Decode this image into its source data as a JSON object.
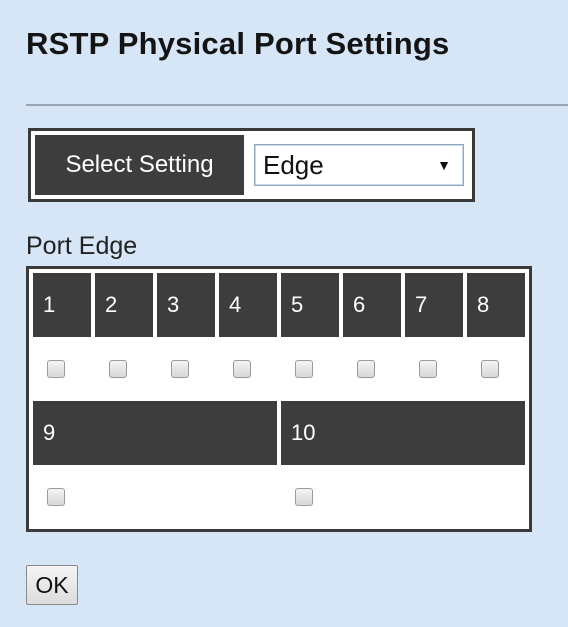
{
  "page": {
    "title": "RSTP Physical Port Settings"
  },
  "select": {
    "label": "Select Setting",
    "value": "Edge",
    "arrow_icon": "triangle-down-icon"
  },
  "section": {
    "label": "Port Edge"
  },
  "ports_row1": [
    {
      "label": "1",
      "checked": false
    },
    {
      "label": "2",
      "checked": false
    },
    {
      "label": "3",
      "checked": false
    },
    {
      "label": "4",
      "checked": false
    },
    {
      "label": "5",
      "checked": false
    },
    {
      "label": "6",
      "checked": false
    },
    {
      "label": "7",
      "checked": false
    },
    {
      "label": "8",
      "checked": false
    }
  ],
  "ports_row2": [
    {
      "label": "9",
      "checked": false
    },
    {
      "label": "10",
      "checked": false
    }
  ],
  "buttons": {
    "ok_label": "OK"
  },
  "colors": {
    "background": "#d6e6f7",
    "header_cell": "#3d3d3d",
    "border": "#3a3a3a"
  }
}
